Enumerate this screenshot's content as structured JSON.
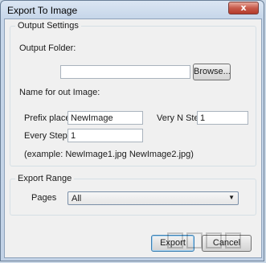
{
  "window": {
    "title": "Export To Image",
    "close_glyph": "x"
  },
  "output_settings": {
    "group_title": "Output Settings",
    "output_folder_label": "Output Folder:",
    "output_folder_value": "",
    "browse_label": "Browse...",
    "name_label": "Name for out Image:",
    "prefix_label": "Prefix places:",
    "prefix_value": "NewImage",
    "very_n_step_label": "Very N Step:",
    "very_n_step_value": "1",
    "every_step_label": "Every Step:",
    "every_step_value": "1",
    "example_text": "(example: NewImage1.jpg NewImage2.jpg)"
  },
  "export_range": {
    "group_title": "Export Range",
    "pages_label": "Pages",
    "pages_value": "All"
  },
  "buttons": {
    "export": "Export",
    "cancel": "Cancel"
  },
  "colors": {
    "accent": "#3c7fb1",
    "close": "#c75a4a"
  }
}
